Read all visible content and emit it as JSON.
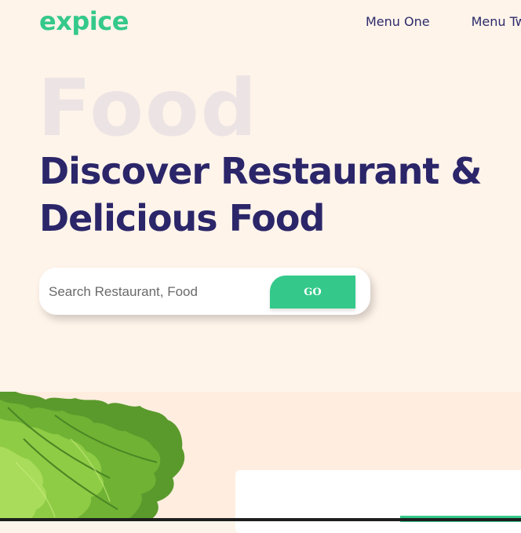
{
  "header": {
    "logo": "expice",
    "nav": [
      {
        "label": "Menu One"
      },
      {
        "label": "Menu Two"
      }
    ]
  },
  "hero": {
    "background_word": "Food",
    "headline_line1": "Discover Restaurant &",
    "headline_line2": "Delicious Food",
    "search": {
      "placeholder": "Search Restaurant, Food",
      "button_label": "GO"
    }
  },
  "colors": {
    "accent": "#34c98a",
    "heading": "#2b2669",
    "background": "#fff4ea"
  },
  "icons": [
    "lettuce-image"
  ]
}
